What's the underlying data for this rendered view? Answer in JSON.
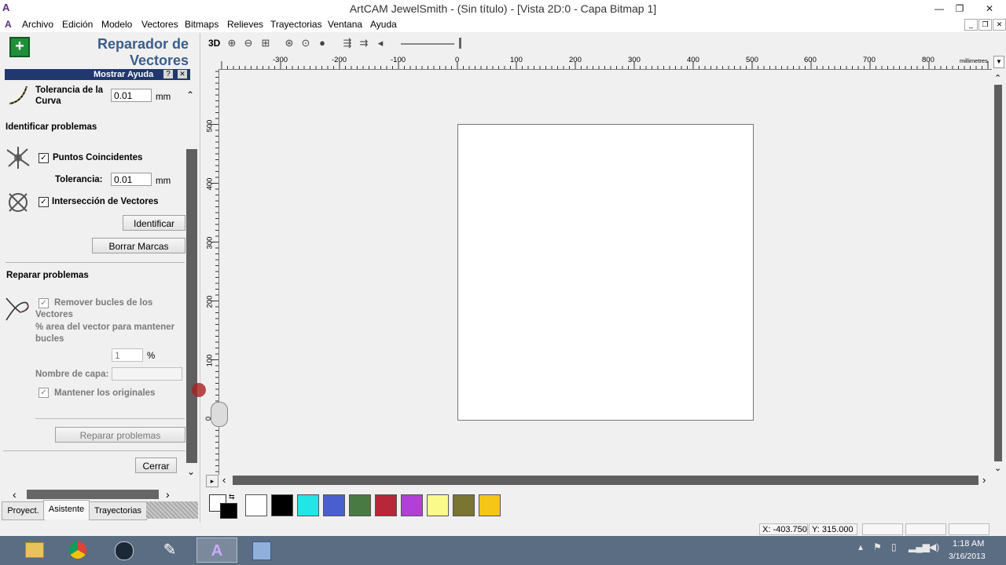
{
  "window": {
    "title": "ArtCAM JewelSmith - (Sin título) - [Vista 2D:0 - Capa Bitmap 1]",
    "app_icon": "artcam-logo",
    "minimize": "—",
    "restore": "❐",
    "close": "✕"
  },
  "menu": [
    "Archivo",
    "Edición",
    "Modelo",
    "Vectores",
    "Bitmaps",
    "Relieves",
    "Trayectorias",
    "Ventana",
    "Ayuda"
  ],
  "panel": {
    "title_line1": "Reparador de",
    "title_line2": "Vectores",
    "help_bar": "Mostrar Ayuda",
    "help_q": "?",
    "help_x": "✕",
    "curve_tol_line1": "Tolerancia de la",
    "curve_tol_line2": "Curva",
    "curve_tol_value": "0.01",
    "unit": "mm",
    "identify_heading": "Identificar problemas",
    "coincident_label": "Puntos Coincidentes",
    "tolerance_label": "Tolerancia:",
    "tolerance_value": "0.01",
    "intersection_label": "Intersección de Vectores",
    "identify_button": "Identificar",
    "clear_marks_button": "Borrar Marcas",
    "repair_heading": "Reparar problemas",
    "remove_loops_line1": "Remover bucles de los",
    "remove_loops_line2": "Vectores",
    "percent_line1": "% area del vector para mantener",
    "percent_line2": "bucles",
    "percent_value": "1",
    "percent_unit": "%",
    "layer_name_label": "Nombre de capa:",
    "layer_name_value": "",
    "keep_originals": "Mantener los originales",
    "repair_button": "Reparar problemas",
    "close_button": "Cerrar",
    "tabs": [
      "Proyect.",
      "Asistente",
      "Trayectorias"
    ],
    "active_tab": "Asistente"
  },
  "toolbar": {
    "view3d_label": "3D"
  },
  "ruler": {
    "h_labels": [
      "-300",
      "-200",
      "-100",
      "0",
      "100",
      "200",
      "300",
      "400",
      "500",
      "600",
      "700",
      "800"
    ],
    "h_unit": "millimetres",
    "v_labels": [
      "500",
      "400",
      "300",
      "200",
      "100",
      "0"
    ]
  },
  "palette": {
    "colors": [
      "#ffffff",
      "#000000",
      "#22e5e5",
      "#4a5fcf",
      "#4a7a44",
      "#b8263a",
      "#b040d8",
      "#fafa8a",
      "#7a7530",
      "#f5c518"
    ]
  },
  "status": {
    "x": "X: -403.750",
    "y": "Y: 315.000"
  },
  "taskbar": {
    "time": "1:18 AM",
    "date": "3/16/2013",
    "apps": [
      "file-explorer-icon",
      "chrome-icon",
      "steam-icon",
      "pen-tool-icon",
      "artcam-icon",
      "floppy-icon"
    ]
  }
}
